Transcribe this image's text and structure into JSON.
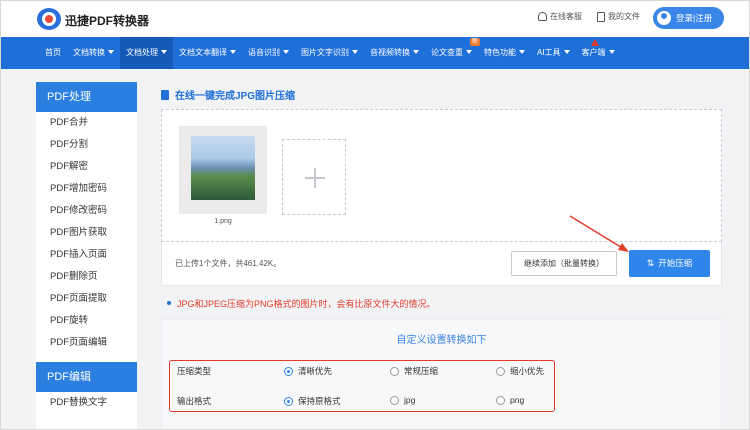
{
  "header": {
    "brand": "迅捷PDF转换器",
    "service": "在线客服",
    "my_files": "我的文件",
    "login": "登录|注册"
  },
  "nav": [
    {
      "label": "首页",
      "caret": false
    },
    {
      "label": "文档转换",
      "caret": true
    },
    {
      "label": "文档处理",
      "caret": true,
      "active": true
    },
    {
      "label": "文档文本翻译",
      "caret": true
    },
    {
      "label": "语音识别",
      "caret": true
    },
    {
      "label": "图片文字识别",
      "caret": true
    },
    {
      "label": "音视频转换",
      "caret": true
    },
    {
      "label": "论文查重",
      "caret": true,
      "badge": "新"
    },
    {
      "label": "特色功能",
      "caret": true
    },
    {
      "label": "AI工具",
      "caret": true
    },
    {
      "label": "客户端",
      "caret": true
    }
  ],
  "sidebar": {
    "section1": "PDF处理",
    "items1": [
      "PDF合并",
      "PDF分割",
      "PDF解密",
      "PDF增加密码",
      "PDF修改密码",
      "PDF图片获取",
      "PDF插入页面",
      "PDF删除页",
      "PDF页面提取",
      "PDF旋转",
      "PDF页面编辑"
    ],
    "section2": "PDF编辑",
    "items2": [
      "PDF替换文字"
    ]
  },
  "main": {
    "title": "在线一键完成JPG图片压缩",
    "file_name": "1.png",
    "status": "已上传1个文件，共461.42K。",
    "add_more": "继续添加（批量转换）",
    "start": "开始压缩",
    "notice": "JPG和JPEG压缩为PNG格式的图片时，会有比原文件大的情况。"
  },
  "settings": {
    "title": "自定义设置转换如下",
    "compress_label": "压缩类型",
    "compress_options": [
      "清晰优先",
      "常规压缩",
      "缩小优先"
    ],
    "compress_selected": 0,
    "format_label": "输出格式",
    "format_options": [
      "保持原格式",
      "jpg",
      "png"
    ],
    "format_selected": 0
  }
}
